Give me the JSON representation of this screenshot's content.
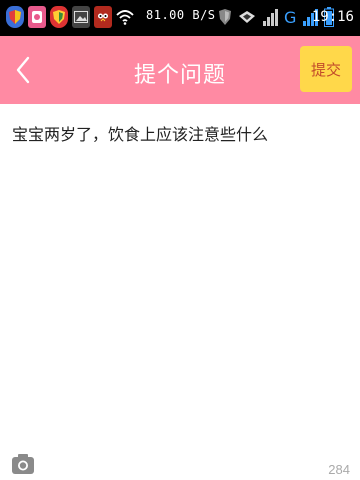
{
  "status_bar": {
    "speed": "81.00 B/S",
    "time": "19:16",
    "network": "G"
  },
  "header": {
    "title": "提个问题",
    "submit_label": "提交"
  },
  "question": {
    "text": "宝宝两岁了，饮食上应该注意些什么"
  },
  "footer": {
    "char_count": "284"
  },
  "colors": {
    "header_bg": "#ff8aa3",
    "submit_bg": "#ffd84a"
  }
}
